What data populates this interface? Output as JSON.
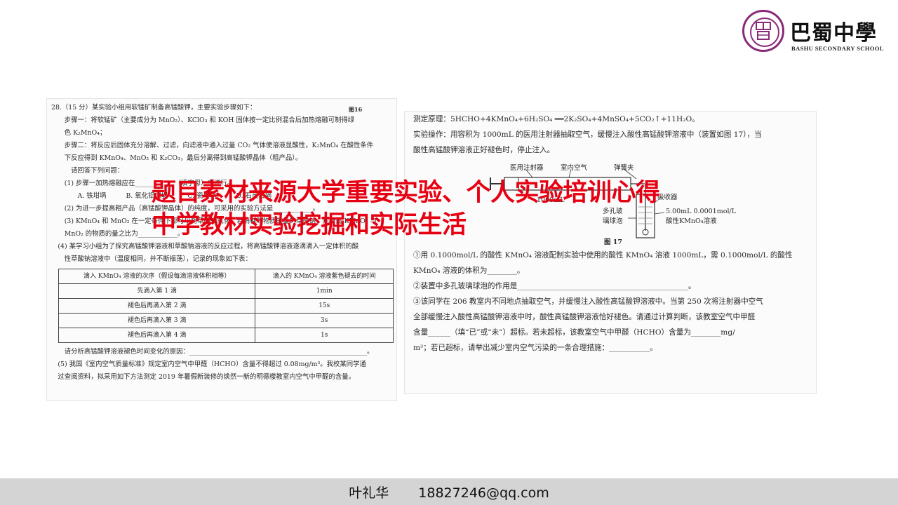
{
  "logo": {
    "name": "巴蜀中學",
    "english": "BASHU SECONDARY SCHOOL",
    "seal_color": "#8a2a78"
  },
  "left_paper": {
    "fig_tag": "图16",
    "lines": [
      "28.（15 分）某实验小组用软锰矿制备高锰酸钾，主要实验步骤如下：",
      "　　步骤一：将软锰矿（主要成分为 MnO₂）、KClO₃ 和 KOH 固体按一定比例混合后加热熔融可制得绿",
      "　　色 K₂MnO₄；",
      "　　步骤二：将反应后固体充分溶解、过滤，向滤液中通入过量 CO₂ 气体使溶液显酸性，K₂MnO₄ 在酸性条件",
      "　　下反应得到 KMnO₄、MnO₂ 和 K₂CO₃，最后分离得到高锰酸钾晶体（粗产品）。",
      "　　　请回答下列问题：",
      "　　(1) 步骤一加热熔融应在____________（填字母）中进行。",
      "　　　　A. 铁坩埚　　　B. 氧化铝坩埚　　　C. 瓷坩埚　　　D. 石英坩埚",
      "　　(2) 为进一步提高粗产品（高锰酸钾晶体）的纯度，可采用的实验方法是____________。",
      "　　(3) KMnO₄ 和 MnO₂ 在一定条件下都可以将草酸钠氧化，若消耗等物质的量的草酸钠，则所需 KMnO₄ 与",
      "　　MnO₂ 的物质的量之比为____________。",
      "　(4) 某学习小组为了探究高锰酸钾溶液和草酸钠溶液的反应过程，将高锰酸钾溶液逐滴滴入一定体积的酸",
      "　　性草酸钠溶液中（温度相同，并不断振荡），记录的现象如下表："
    ],
    "table": {
      "headers": [
        "滴入 KMnO₄ 溶液的次序（假设每滴溶液体积相等）",
        "滴入的 KMnO₄ 溶液紫色褪去的时间"
      ],
      "rows": [
        [
          "先滴入第 1 滴",
          "1min"
        ],
        [
          "褪色后再滴入第 2 滴",
          "15s"
        ],
        [
          "褪色后再滴入第 3 滴",
          "3s"
        ],
        [
          "褪色后再滴入第 4 滴",
          "1s"
        ]
      ]
    },
    "after_lines": [
      "　　请分析高锰酸钾溶液褪色时间变化的原因：______________________________________________________。",
      "　(5) 我国《室内空气质量标准》规定室内空气中甲醛（HCHO）含量不得超过 0.08mg/m³。我校某同学通",
      "　过查阅资料，拟采用如下方法测定 2019 年暑假新装修的焕然一新的明德楼教室内空气中甲醛的含量。"
    ]
  },
  "right_paper": {
    "lines_top": [
      "测定原理：5HCHO+4KMnO₄+6H₂SO₄ ══2K₂SO₄+4MnSO₄+5CO₂↑+11H₂O。",
      "实验操作：用容积为 1000mL 的医用注射器抽取空气，缓慢注入酸性高锰酸钾溶液中（装置如图 17），当",
      "酸性高锰酸钾溶液正好褪色时，停止注入。"
    ],
    "apparatus": {
      "syringe": "医用注射器",
      "air": "室内空气",
      "spring_clip": "弹簧夹",
      "volume": "1000mL",
      "absorber": "吸收器",
      "bubbler_1": "多孔玻",
      "bubbler_2": "璃球泡",
      "solution_1": "5.00mL 0.0001mol/L",
      "solution_2": "酸性KMnO₄溶液",
      "caption": "图 17"
    },
    "lines_bottom": [
      "①用 0.1000mol/L 的酸性 KMnO₄ 溶液配制实验中使用的酸性 KMnO₄ 溶液 1000mL，需 0.1000mol/L 的酸性",
      "KMnO₄ 溶液的体积为________。",
      "②装置中多孔玻璃球泡的作用是______________________________________________。",
      "③该同学在 206 教室内不同地点抽取空气，并缓慢注入酸性高锰酸钾溶液中。当第 250 次将注射器中空气",
      "全部缓慢注入酸性高锰酸钾溶液中时，酸性高锰酸钾溶液恰好褪色。请通过计算判断，该教室空气中甲醛",
      "含量______（填“已”或“未”）超标。若未超标，该教室空气中甲醛（HCHO）含量为________mg/",
      "m³；若已超标，请举出减少室内空气污染的一条合理措施：___________。"
    ]
  },
  "overlay": {
    "line1": "题目素材来源大学重要实验、个人实验培训心得",
    "line2": "中学教材实验挖掘和实际生活",
    "color": "#e60012"
  },
  "footer": {
    "name": "叶礼华",
    "email": "18827246@qq.com",
    "bg_color": "#d4d4d4"
  }
}
